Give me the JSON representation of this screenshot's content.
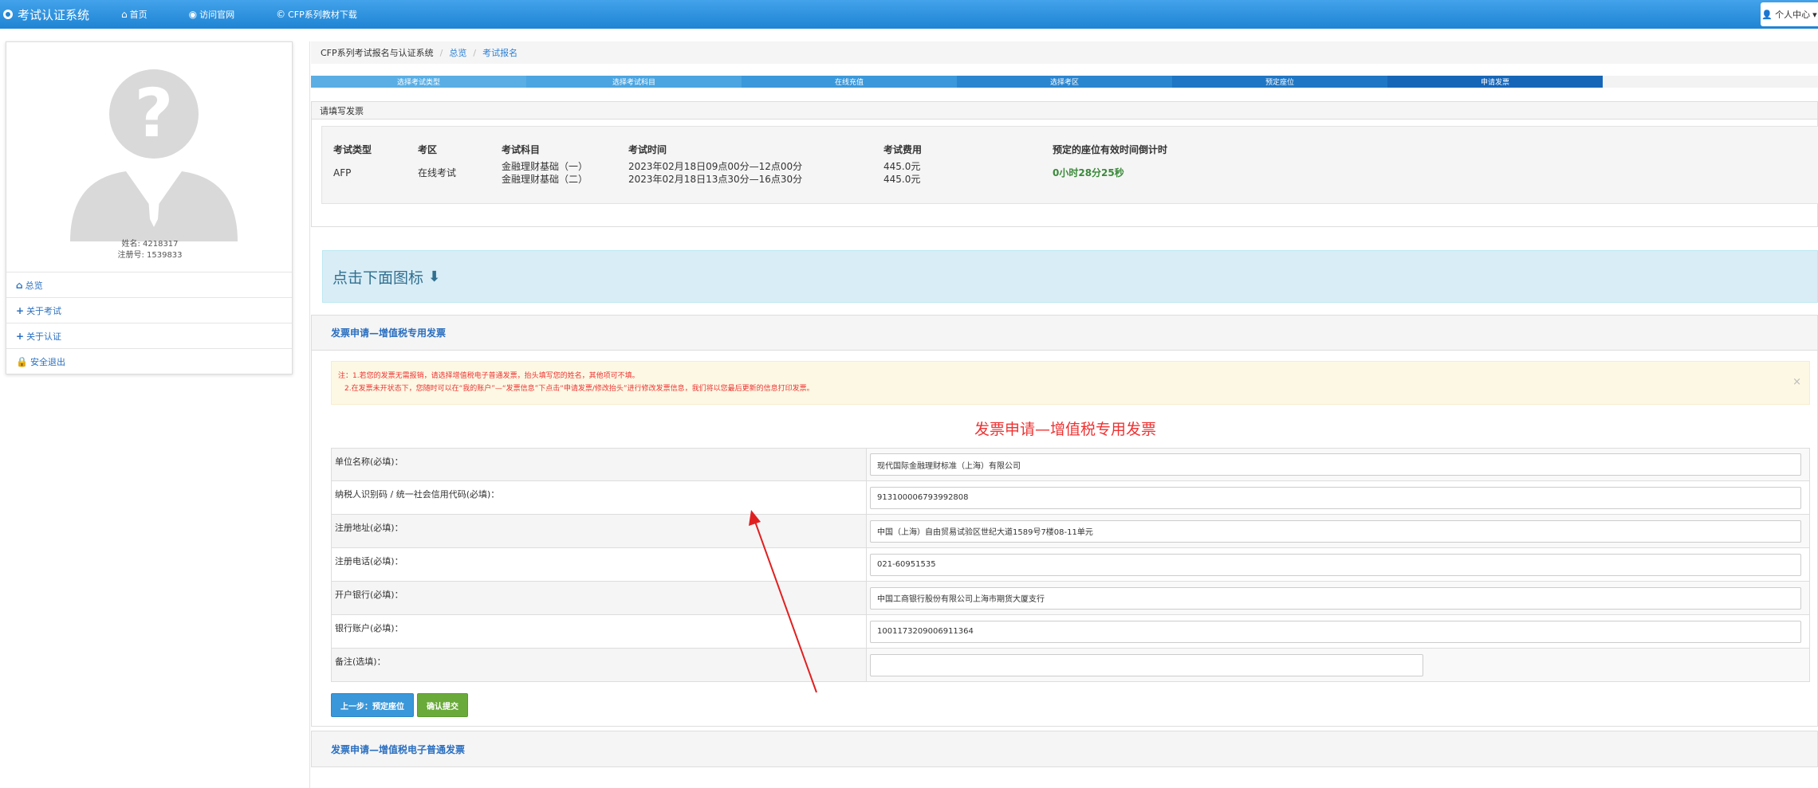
{
  "nav": {
    "brand": "考试认证系统",
    "items": [
      "首页",
      "访问官网",
      "CFP系列教材下载"
    ],
    "user_menu": "个人中心"
  },
  "sidebar": {
    "name_line": "姓名: 4218317",
    "reg_line": "注册号: 1539833",
    "menu": [
      "总览",
      "关于考试",
      "关于认证",
      "安全退出"
    ]
  },
  "breadcrumb": {
    "root": "CFP系列考试报名与认证系统",
    "items": [
      "总览",
      "考试报名"
    ]
  },
  "steps": [
    {
      "label": "选择考试类型",
      "color": "#5aaee4"
    },
    {
      "label": "选择考试科目",
      "color": "#4ca5e0"
    },
    {
      "label": "在线充值",
      "color": "#3b98da"
    },
    {
      "label": "选择考区",
      "color": "#2b86d0"
    },
    {
      "label": "预定座位",
      "color": "#1f76c4"
    },
    {
      "label": "申请发票",
      "color": "#1666b8"
    }
  ],
  "invoice_panel": {
    "heading": "请填写发票",
    "headers": [
      "考试类型",
      "考区",
      "考试科目",
      "考试时间",
      "考试费用",
      "预定的座位有效时间倒计时"
    ],
    "row": {
      "type": "AFP",
      "area": "在线考试",
      "subjects": [
        "金融理财基础（一）",
        "金融理财基础（二）"
      ],
      "times": [
        "2023年02月18日09点00分—12点00分",
        "2023年02月18日13点30分—16点30分"
      ],
      "fees": [
        "445.0元",
        "445.0元"
      ],
      "countdown": "0小时28分25秒"
    }
  },
  "click_hint": "点击下面图标",
  "vat_panel": {
    "heading": "发票申请—增值税专用发票",
    "notice_line1": "注：1.若您的发票无需报销，请选择增值税电子普通发票，抬头填写您的姓名，其他项可不填。",
    "notice_line2": "2.在发票未开状态下，您随时可以在“我的账户”—“发票信息”下点击“申请发票/修改抬头”进行修改发票信息，我们将以您最后更新的信息打印发票。",
    "form_title": "发票申请—增值税专用发票",
    "fields": [
      {
        "label": "单位名称(必填)：",
        "value": "现代国际金融理财标准（上海）有限公司"
      },
      {
        "label": "纳税人识别码 / 统一社会信用代码(必填)：",
        "value": "913100006793992808"
      },
      {
        "label": "注册地址(必填)：",
        "value": "中国（上海）自由贸易试验区世纪大道1589号7楼08-11单元"
      },
      {
        "label": "注册电话(必填)：",
        "value": "021-60951535"
      },
      {
        "label": "开户银行(必填)：",
        "value": "中国工商银行股份有限公司上海市期货大厦支行"
      },
      {
        "label": "银行账户(必填)：",
        "value": "1001173209006911364"
      },
      {
        "label": "备注(选填)：",
        "value": ""
      }
    ],
    "btn_prev": "上一步：预定座位",
    "btn_submit": "确认提交"
  },
  "e_invoice_heading": "发票申请—增值税电子普通发票",
  "colors": {
    "brand": "#1f84d4",
    "link": "#2a6fc0",
    "alert_red": "#e33333",
    "arrow": "#e02020"
  }
}
